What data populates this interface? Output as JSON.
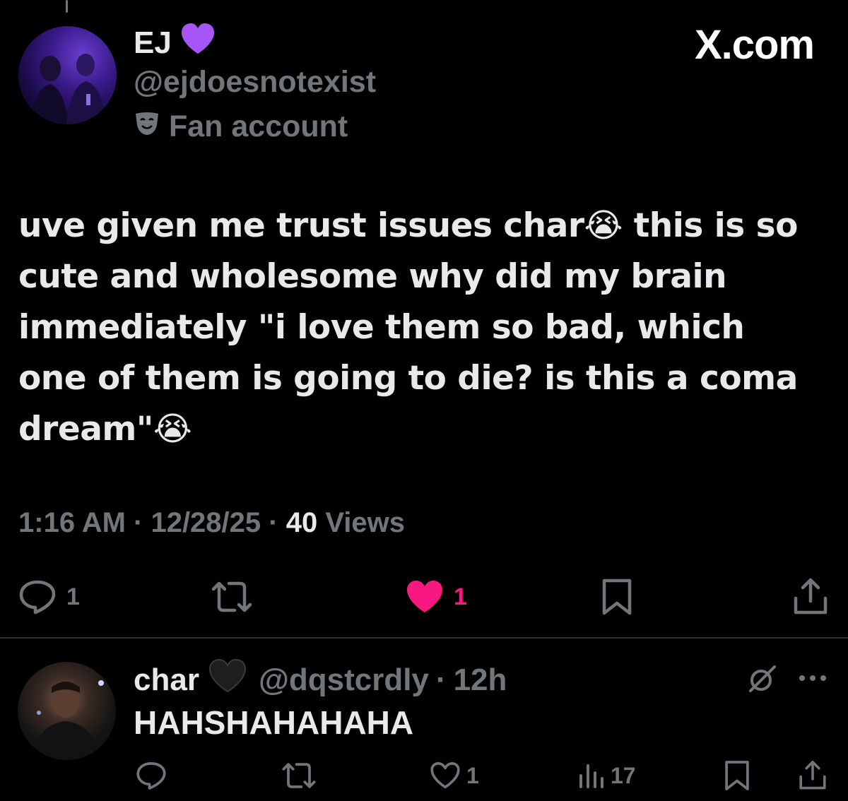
{
  "tweet": {
    "author_name": "EJ",
    "author_handle": "@ejdoesnotexist",
    "account_label": "Fan account",
    "brand": "X.com",
    "text": "uve given me trust issues char😭 this is so cute and wholesome why did my brain immediately \"i love them so bad, which one of them is going to die? is this a coma dream\"😭",
    "time": "1:16 AM",
    "date": "12/28/25",
    "views_count": "40",
    "views_label": "Views",
    "reply_count": "1",
    "like_count": "1",
    "like_color": "#f91880"
  },
  "reply": {
    "author_name": "char",
    "author_handle": "@dqstcrdly",
    "age": "12h",
    "text": "HAHSHAHAHAHA",
    "like_count": "1",
    "view_count": "17"
  },
  "icons": {
    "name_badge": "purple-heart-icon",
    "reply_name_badge": "black-heart-icon",
    "label_icon": "theater-mask-icon",
    "reply": "reply-icon",
    "retweet": "retweet-icon",
    "like": "heart-icon",
    "bookmark": "bookmark-icon",
    "share": "share-icon",
    "views": "views-bar-icon",
    "grok": "grok-icon",
    "more": "more-dots-icon"
  }
}
